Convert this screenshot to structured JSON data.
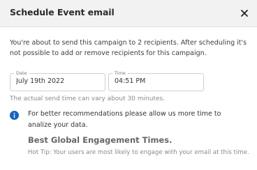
{
  "dialog": {
    "title": "Schedule Event email",
    "intro": "You're about to send this campaign to 2 recipients. After scheduling it's not possible to add or remove recipients for this campaign.",
    "date": {
      "label": "Date",
      "value": "July 19th 2022"
    },
    "time": {
      "label": "Time",
      "value": "04:51 PM"
    },
    "hint": "The actual send time can vary about 30 minutes.",
    "info_text": "For better recommendations please allow us more time to analize your data.",
    "best_heading": "Best Global Engagement Times.",
    "tip": "Hot Tip: Your users are most likely to engage with your email at this time.",
    "colors": {
      "header_bg": "#f2f2f2",
      "info_icon": "#1565c0"
    },
    "icons": {
      "close": "close-icon",
      "info": "info-icon"
    }
  }
}
